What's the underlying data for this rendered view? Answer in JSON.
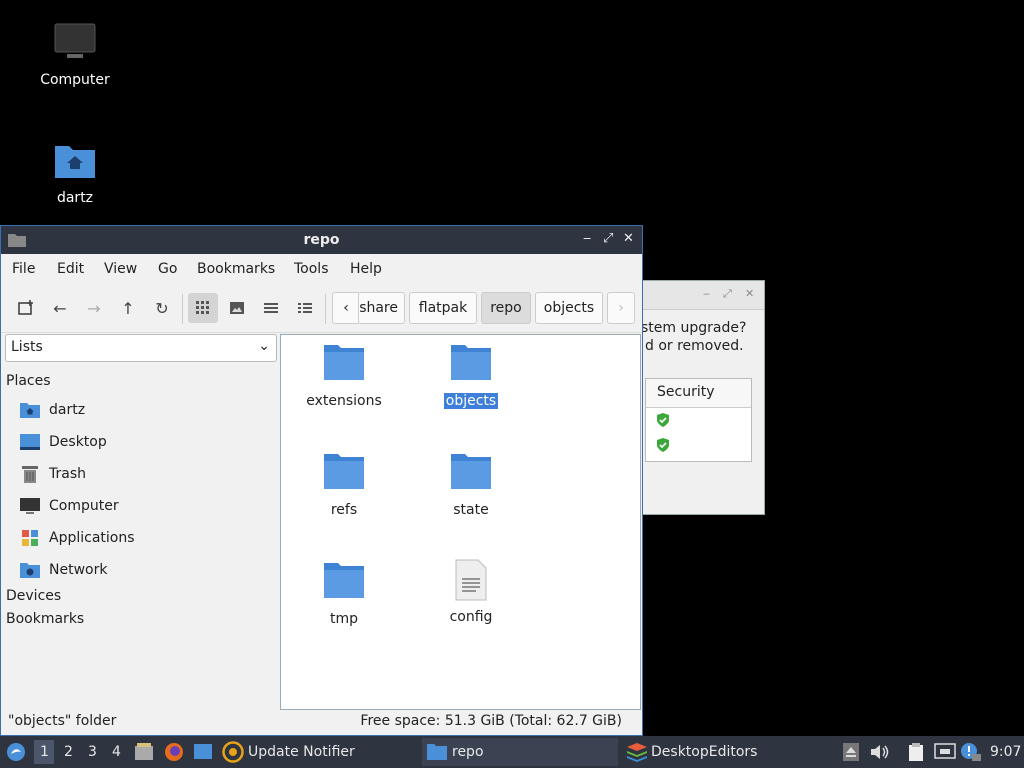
{
  "desktop": {
    "icons": [
      {
        "label": "Computer",
        "icon": "monitor-icon"
      },
      {
        "label": "dartz",
        "icon": "home-folder-icon"
      }
    ]
  },
  "background_window": {
    "line1": "stem upgrade?",
    "line2": "d or removed.",
    "table_header": "Security",
    "rows": [
      "shield-check-icon",
      "shield-check-icon"
    ]
  },
  "window": {
    "title": "repo",
    "controls": {
      "minimize": "‒",
      "maximize": "⤢",
      "close": "✕"
    },
    "menu": [
      "File",
      "Edit",
      "View",
      "Go",
      "Bookmarks",
      "Tools",
      "Help"
    ],
    "breadcrumbs": [
      "share",
      "flatpak",
      "repo",
      "objects"
    ],
    "side_mode": "Lists",
    "places_heading": "Places",
    "places": [
      {
        "label": "dartz",
        "icon": "home-folder-icon"
      },
      {
        "label": "Desktop",
        "icon": "desktop-icon"
      },
      {
        "label": "Trash",
        "icon": "trash-icon"
      },
      {
        "label": "Computer",
        "icon": "computer-icon"
      },
      {
        "label": "Applications",
        "icon": "applications-icon"
      },
      {
        "label": "Network",
        "icon": "network-icon"
      }
    ],
    "devices_heading": "Devices",
    "bookmarks_heading": "Bookmarks",
    "files": [
      {
        "name": "extensions",
        "type": "folder"
      },
      {
        "name": "objects",
        "type": "folder",
        "selected": true
      },
      {
        "name": "refs",
        "type": "folder"
      },
      {
        "name": "state",
        "type": "folder"
      },
      {
        "name": "tmp",
        "type": "folder"
      },
      {
        "name": "config",
        "type": "file"
      }
    ],
    "status_left": "\"objects\" folder",
    "status_right": "Free space: 51.3 GiB (Total: 62.7 GiB)"
  },
  "taskbar": {
    "workspaces": [
      "1",
      "2",
      "3",
      "4"
    ],
    "apps": [
      {
        "label": "Update Notifier",
        "icon": "update-notifier-icon"
      },
      {
        "label": "repo",
        "icon": "folder-icon",
        "active": true
      },
      {
        "label": "DesktopEditors",
        "icon": "desktop-editors-icon"
      }
    ],
    "clock": "9:07"
  },
  "colors": {
    "folder": "#4a90d9",
    "accent": "#3d7fd9",
    "panel": "#2e3440"
  }
}
